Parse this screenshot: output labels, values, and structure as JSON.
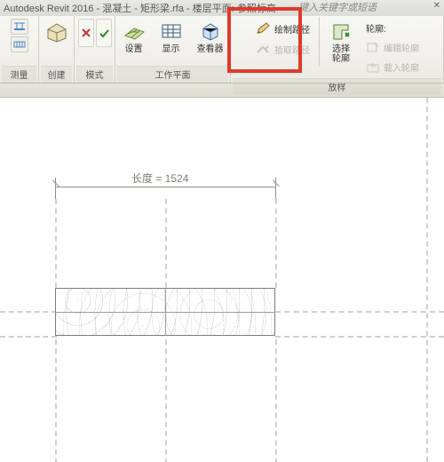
{
  "title": "Autodesk Revit 2016 -   混凝土 - 矩形梁.rfa - 楼层平面: 参照标高",
  "keyword_hint": "键入关键字或短语",
  "ribbon": {
    "panels": {
      "measure": "测量",
      "create": "创建",
      "mode": "模式",
      "workplane": "工作平面",
      "sweep": "放样"
    },
    "buttons": {
      "settings": "设置",
      "display": "显示",
      "viewer": "查看器",
      "draw_path": "绘制路径",
      "pick_path": "拾取路径",
      "profile_label": "轮廓:",
      "select_profile": "选择\n轮廓",
      "edit_profile": "编辑轮廓",
      "load_profile": "载入轮廓"
    }
  },
  "canvas": {
    "dimension_label": "长度 = 1524"
  }
}
